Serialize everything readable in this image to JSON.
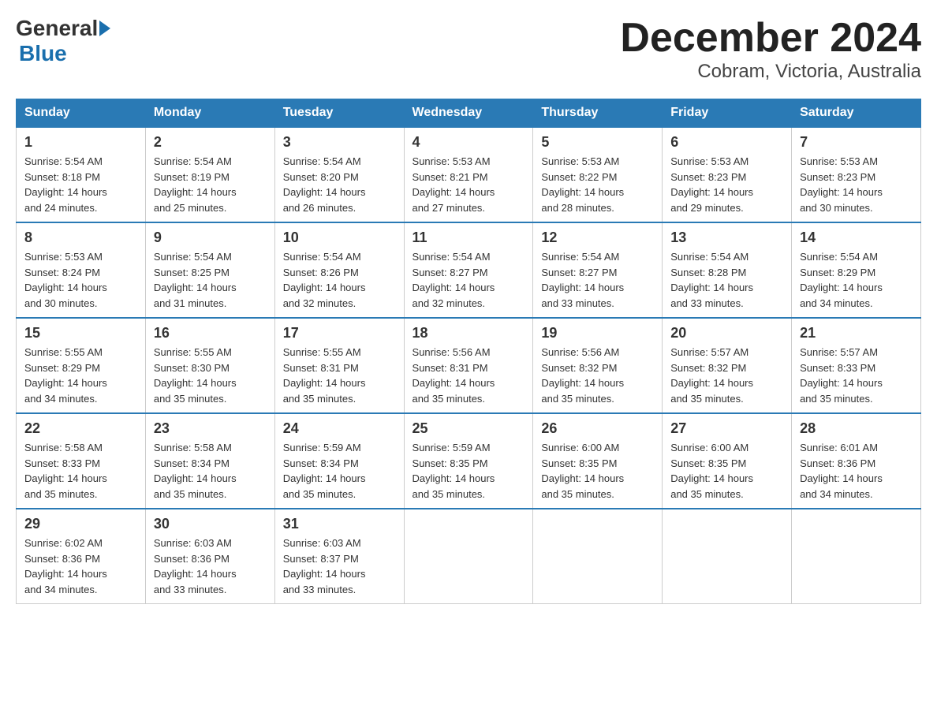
{
  "header": {
    "logo_general": "General",
    "logo_blue": "Blue",
    "title": "December 2024",
    "subtitle": "Cobram, Victoria, Australia"
  },
  "columns": [
    "Sunday",
    "Monday",
    "Tuesday",
    "Wednesday",
    "Thursday",
    "Friday",
    "Saturday"
  ],
  "weeks": [
    [
      {
        "day": "1",
        "sunrise": "5:54 AM",
        "sunset": "8:18 PM",
        "daylight": "14 hours and 24 minutes."
      },
      {
        "day": "2",
        "sunrise": "5:54 AM",
        "sunset": "8:19 PM",
        "daylight": "14 hours and 25 minutes."
      },
      {
        "day": "3",
        "sunrise": "5:54 AM",
        "sunset": "8:20 PM",
        "daylight": "14 hours and 26 minutes."
      },
      {
        "day": "4",
        "sunrise": "5:53 AM",
        "sunset": "8:21 PM",
        "daylight": "14 hours and 27 minutes."
      },
      {
        "day": "5",
        "sunrise": "5:53 AM",
        "sunset": "8:22 PM",
        "daylight": "14 hours and 28 minutes."
      },
      {
        "day": "6",
        "sunrise": "5:53 AM",
        "sunset": "8:23 PM",
        "daylight": "14 hours and 29 minutes."
      },
      {
        "day": "7",
        "sunrise": "5:53 AM",
        "sunset": "8:23 PM",
        "daylight": "14 hours and 30 minutes."
      }
    ],
    [
      {
        "day": "8",
        "sunrise": "5:53 AM",
        "sunset": "8:24 PM",
        "daylight": "14 hours and 30 minutes."
      },
      {
        "day": "9",
        "sunrise": "5:54 AM",
        "sunset": "8:25 PM",
        "daylight": "14 hours and 31 minutes."
      },
      {
        "day": "10",
        "sunrise": "5:54 AM",
        "sunset": "8:26 PM",
        "daylight": "14 hours and 32 minutes."
      },
      {
        "day": "11",
        "sunrise": "5:54 AM",
        "sunset": "8:27 PM",
        "daylight": "14 hours and 32 minutes."
      },
      {
        "day": "12",
        "sunrise": "5:54 AM",
        "sunset": "8:27 PM",
        "daylight": "14 hours and 33 minutes."
      },
      {
        "day": "13",
        "sunrise": "5:54 AM",
        "sunset": "8:28 PM",
        "daylight": "14 hours and 33 minutes."
      },
      {
        "day": "14",
        "sunrise": "5:54 AM",
        "sunset": "8:29 PM",
        "daylight": "14 hours and 34 minutes."
      }
    ],
    [
      {
        "day": "15",
        "sunrise": "5:55 AM",
        "sunset": "8:29 PM",
        "daylight": "14 hours and 34 minutes."
      },
      {
        "day": "16",
        "sunrise": "5:55 AM",
        "sunset": "8:30 PM",
        "daylight": "14 hours and 35 minutes."
      },
      {
        "day": "17",
        "sunrise": "5:55 AM",
        "sunset": "8:31 PM",
        "daylight": "14 hours and 35 minutes."
      },
      {
        "day": "18",
        "sunrise": "5:56 AM",
        "sunset": "8:31 PM",
        "daylight": "14 hours and 35 minutes."
      },
      {
        "day": "19",
        "sunrise": "5:56 AM",
        "sunset": "8:32 PM",
        "daylight": "14 hours and 35 minutes."
      },
      {
        "day": "20",
        "sunrise": "5:57 AM",
        "sunset": "8:32 PM",
        "daylight": "14 hours and 35 minutes."
      },
      {
        "day": "21",
        "sunrise": "5:57 AM",
        "sunset": "8:33 PM",
        "daylight": "14 hours and 35 minutes."
      }
    ],
    [
      {
        "day": "22",
        "sunrise": "5:58 AM",
        "sunset": "8:33 PM",
        "daylight": "14 hours and 35 minutes."
      },
      {
        "day": "23",
        "sunrise": "5:58 AM",
        "sunset": "8:34 PM",
        "daylight": "14 hours and 35 minutes."
      },
      {
        "day": "24",
        "sunrise": "5:59 AM",
        "sunset": "8:34 PM",
        "daylight": "14 hours and 35 minutes."
      },
      {
        "day": "25",
        "sunrise": "5:59 AM",
        "sunset": "8:35 PM",
        "daylight": "14 hours and 35 minutes."
      },
      {
        "day": "26",
        "sunrise": "6:00 AM",
        "sunset": "8:35 PM",
        "daylight": "14 hours and 35 minutes."
      },
      {
        "day": "27",
        "sunrise": "6:00 AM",
        "sunset": "8:35 PM",
        "daylight": "14 hours and 35 minutes."
      },
      {
        "day": "28",
        "sunrise": "6:01 AM",
        "sunset": "8:36 PM",
        "daylight": "14 hours and 34 minutes."
      }
    ],
    [
      {
        "day": "29",
        "sunrise": "6:02 AM",
        "sunset": "8:36 PM",
        "daylight": "14 hours and 34 minutes."
      },
      {
        "day": "30",
        "sunrise": "6:03 AM",
        "sunset": "8:36 PM",
        "daylight": "14 hours and 33 minutes."
      },
      {
        "day": "31",
        "sunrise": "6:03 AM",
        "sunset": "8:37 PM",
        "daylight": "14 hours and 33 minutes."
      },
      null,
      null,
      null,
      null
    ]
  ],
  "labels": {
    "sunrise": "Sunrise:",
    "sunset": "Sunset:",
    "daylight": "Daylight:"
  }
}
